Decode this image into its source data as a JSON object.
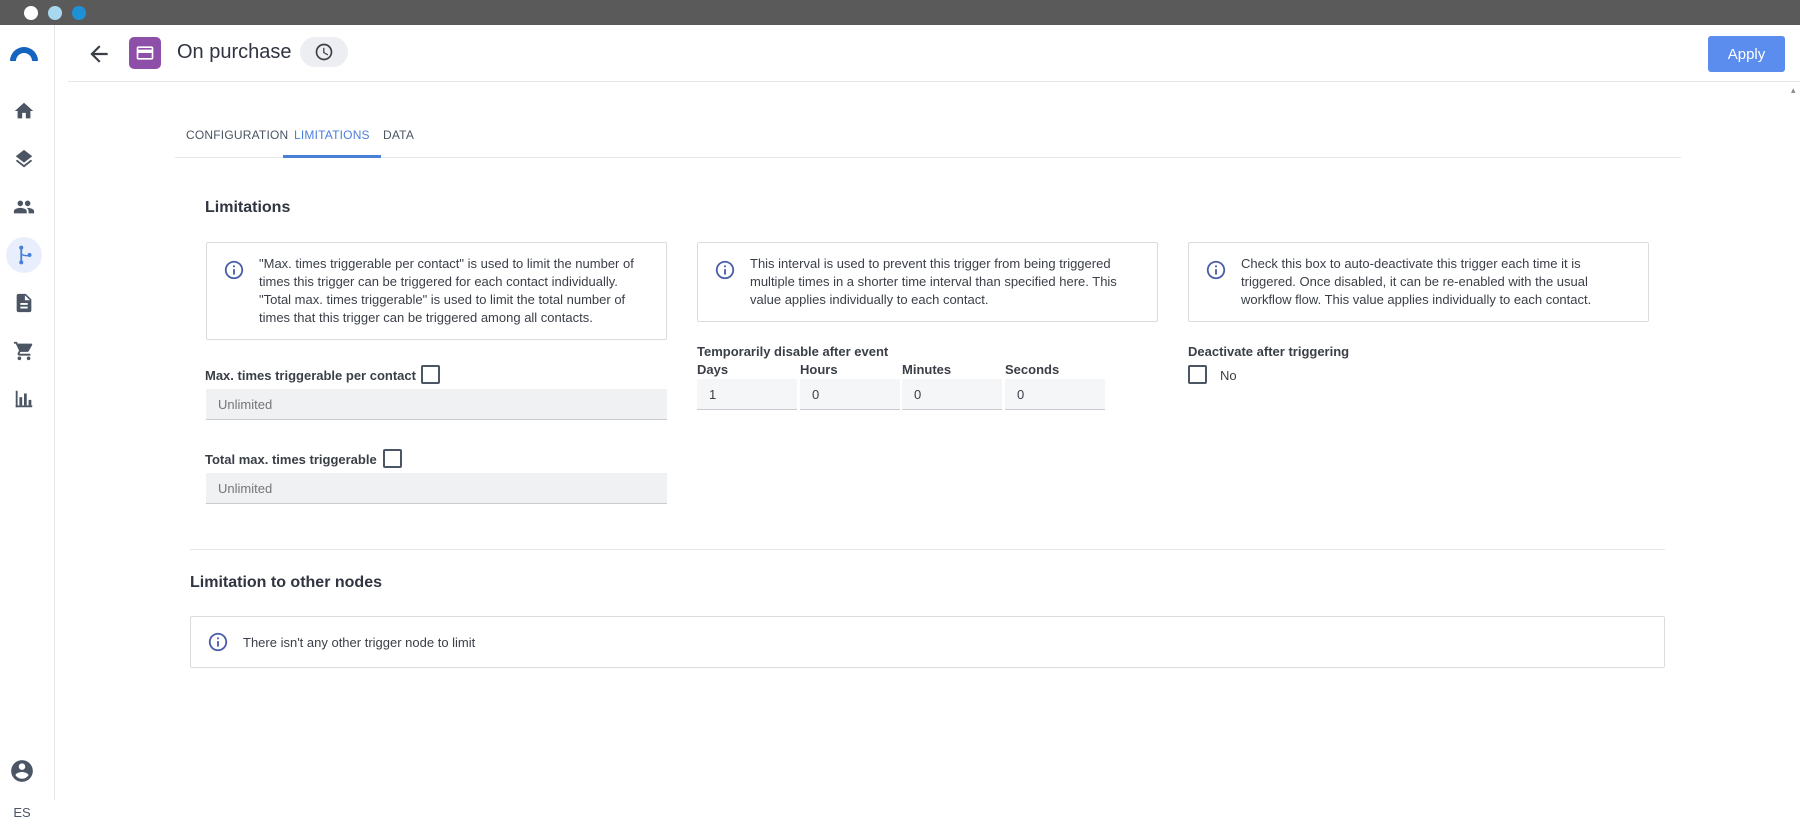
{
  "window": {
    "controls": [
      "close",
      "minimize",
      "maximize"
    ]
  },
  "sidebar": {
    "items": [
      {
        "icon": "home-icon",
        "active": false
      },
      {
        "icon": "layers-icon",
        "active": false
      },
      {
        "icon": "contacts-icon",
        "active": false
      },
      {
        "icon": "workflow-icon",
        "active": true
      },
      {
        "icon": "document-icon",
        "active": false
      },
      {
        "icon": "cart-icon",
        "active": false
      },
      {
        "icon": "bar-chart-icon",
        "active": false
      }
    ],
    "language": "ES"
  },
  "header": {
    "title": "On purchase",
    "apply_label": "Apply"
  },
  "tabs": [
    {
      "label": "CONFIGURATION",
      "active": false
    },
    {
      "label": "LIMITATIONS",
      "active": true
    },
    {
      "label": "DATA",
      "active": false
    }
  ],
  "limitations": {
    "title": "Limitations",
    "info_max": "\"Max. times triggerable per contact\" is used to limit the number of times this trigger can be triggered for each contact individually. \"Total max. times triggerable\" is used to limit the total number of times that this trigger can be triggered among all contacts.",
    "info_interval": "This interval is used to prevent this trigger from being triggered multiple times in a shorter time interval than specified here. This value applies individually to each contact.",
    "info_deactivate": "Check this box to auto-deactivate this trigger each time it is triggered. Once disabled, it can be re-enabled with the usual workflow flow. This value applies individually to each contact.",
    "max_per_contact_label": "Max. times triggerable per contact",
    "max_per_contact_placeholder": "Unlimited",
    "total_max_label": "Total max. times triggerable",
    "total_max_placeholder": "Unlimited",
    "temp_disable_label": "Temporarily disable after event",
    "days_label": "Days",
    "days_value": "1",
    "hours_label": "Hours",
    "hours_value": "0",
    "minutes_label": "Minutes",
    "minutes_value": "0",
    "seconds_label": "Seconds",
    "seconds_value": "0",
    "deactivate_label": "Deactivate after triggering",
    "deactivate_value_label": "No"
  },
  "other_nodes": {
    "title": "Limitation to other nodes",
    "info": "There isn't any other trigger node to limit"
  },
  "colors": {
    "accent": "#4a7fd9",
    "apply_button": "#5b8def",
    "node_icon": "#8d4fa8",
    "info_icon": "#4a5fa8"
  }
}
